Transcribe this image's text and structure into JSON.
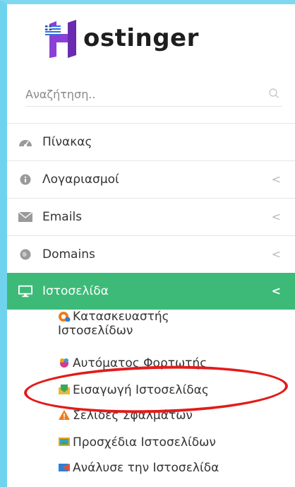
{
  "brand": {
    "name": "ostinger"
  },
  "search": {
    "placeholder": "Αναζήτηση.."
  },
  "menu": {
    "items": [
      {
        "label": "Πίνακας",
        "icon": "dashboard-icon",
        "chevron": ""
      },
      {
        "label": "Λογαριασμοί",
        "icon": "info-icon",
        "chevron": "<"
      },
      {
        "label": "Emails",
        "icon": "mail-icon",
        "chevron": "<"
      },
      {
        "label": "Domains",
        "icon": "globe-icon",
        "chevron": "<"
      },
      {
        "label": "Ιστοσελίδα",
        "icon": "monitor-icon",
        "chevron": "<"
      }
    ]
  },
  "submenu": {
    "items": [
      {
        "label": "Κατασκευαστής",
        "label2": "Ιστοσελίδων",
        "icon": "builder-icon"
      },
      {
        "label": "Αυτόματος Φορτωτής",
        "icon": "auto-installer-icon"
      },
      {
        "label": "Εισαγωγή Ιστοσελίδας",
        "icon": "import-icon"
      },
      {
        "label": "Σελίδες Σφαλμάτων",
        "icon": "warning-icon"
      },
      {
        "label": "Προσχέδια Ιστοσελίδων",
        "icon": "templates-icon"
      },
      {
        "label": "Ανάλυσε την Ιστοσελίδα",
        "icon": "analyze-icon"
      }
    ]
  },
  "colors": {
    "active": "#3dba78",
    "highlight": "#e31b1b",
    "frame": "#6fd3ee"
  }
}
